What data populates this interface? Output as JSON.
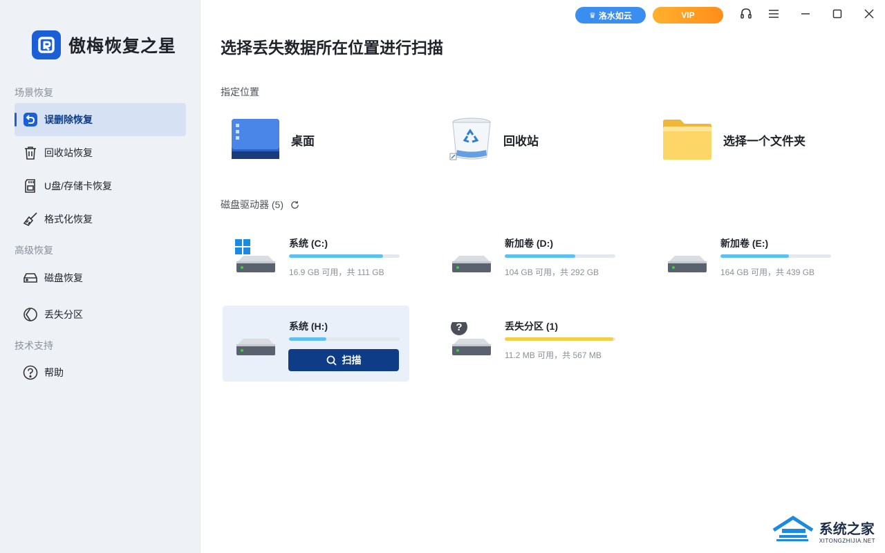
{
  "app": {
    "name": "傲梅恢复之星"
  },
  "titlebar": {
    "cloud_label": "洛水如云",
    "vip_label": "VIP"
  },
  "sidebar": {
    "section_scene": "场景恢复",
    "section_advanced": "高级恢复",
    "section_support": "技术支持",
    "items": [
      {
        "label": "误删除恢复",
        "icon": "undo-icon",
        "active": true
      },
      {
        "label": "回收站恢复",
        "icon": "trash-icon"
      },
      {
        "label": "U盘/存储卡恢复",
        "icon": "sd-card-icon"
      },
      {
        "label": "格式化恢复",
        "icon": "broom-icon"
      },
      {
        "label": "磁盘恢复",
        "icon": "disk-icon"
      },
      {
        "label": "丢失分区",
        "icon": "partition-icon"
      },
      {
        "label": "帮助",
        "icon": "help-icon"
      }
    ]
  },
  "main": {
    "title": "选择丢失数据所在位置进行扫描",
    "locations_label": "指定位置",
    "locations": [
      {
        "label": "桌面",
        "icon": "desktop-icon"
      },
      {
        "label": "回收站",
        "icon": "recycle-bin-icon"
      },
      {
        "label": "选择一个文件夹",
        "icon": "folder-icon"
      }
    ],
    "drives_label": "磁盘驱动器 (5)",
    "drives": [
      {
        "name": "系统 (C:)",
        "info": "16.9 GB 可用，共 111 GB",
        "used": 0.85,
        "color": "#5cc0f0"
      },
      {
        "name": "新加卷 (D:)",
        "info": "104 GB 可用，共 292 GB",
        "used": 0.64,
        "color": "#5cc0f0"
      },
      {
        "name": "新加卷 (E:)",
        "info": "164 GB 可用，共 439 GB",
        "used": 0.62,
        "color": "#5cc0f0"
      },
      {
        "name": "系统 (H:)",
        "info": "",
        "used": 0.34,
        "color": "#5cc0f0",
        "selected": true
      },
      {
        "name": "丢失分区 (1)",
        "info": "11.2 MB 可用，共 567 MB",
        "used": 0.98,
        "color": "#f2cf4a"
      }
    ],
    "scan_label": "扫描"
  },
  "watermark": {
    "main": "系统之家",
    "sub": "XITONGZHIJIA.NET"
  }
}
